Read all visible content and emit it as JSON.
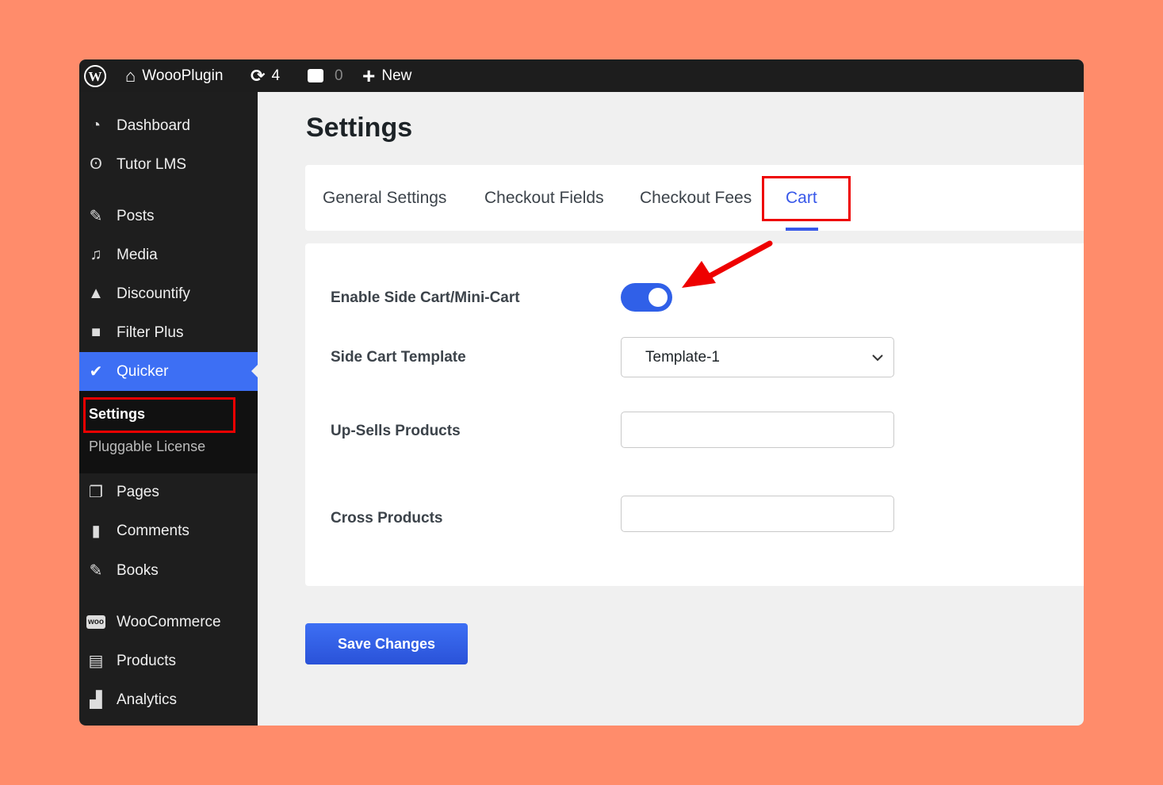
{
  "topbar": {
    "site_name": "WoooPlugin",
    "updates_count": "4",
    "comments_count": "0",
    "new_label": "New"
  },
  "sidebar": {
    "items": [
      {
        "label": "Dashboard",
        "icon": "dashboard-icon"
      },
      {
        "label": "Tutor LMS",
        "icon": "tutor-icon"
      },
      {
        "label": "Posts",
        "icon": "pin-icon"
      },
      {
        "label": "Media",
        "icon": "media-icon"
      },
      {
        "label": "Discountify",
        "icon": "discountify-icon"
      },
      {
        "label": "Filter Plus",
        "icon": "bag-icon"
      },
      {
        "label": "Quicker",
        "icon": "quicker-icon"
      },
      {
        "label": "Pages",
        "icon": "pages-icon"
      },
      {
        "label": "Comments",
        "icon": "comment-icon"
      },
      {
        "label": "Books",
        "icon": "pin-icon"
      },
      {
        "label": "WooCommerce",
        "icon": "woo-icon"
      },
      {
        "label": "Products",
        "icon": "archive-icon"
      },
      {
        "label": "Analytics",
        "icon": "bar-chart-icon"
      }
    ],
    "submenu": [
      {
        "label": "Settings"
      },
      {
        "label": "Pluggable License"
      }
    ]
  },
  "main": {
    "title": "Settings",
    "tabs": [
      {
        "label": "General Settings"
      },
      {
        "label": "Checkout Fields"
      },
      {
        "label": "Checkout Fees"
      },
      {
        "label": "Cart",
        "active": true
      }
    ],
    "fields": {
      "enable_side_cart": {
        "label": "Enable Side Cart/Mini-Cart",
        "value": true
      },
      "side_cart_template": {
        "label": "Side Cart Template",
        "value": "Template-1"
      },
      "upsells": {
        "label": "Up-Sells Products",
        "value": ""
      },
      "cross": {
        "label": "Cross Products",
        "value": ""
      }
    },
    "save_label": "Save Changes"
  },
  "colors": {
    "accent": "#3d6ff4",
    "highlight": "#ee0000",
    "background": "#ff8c6b"
  }
}
